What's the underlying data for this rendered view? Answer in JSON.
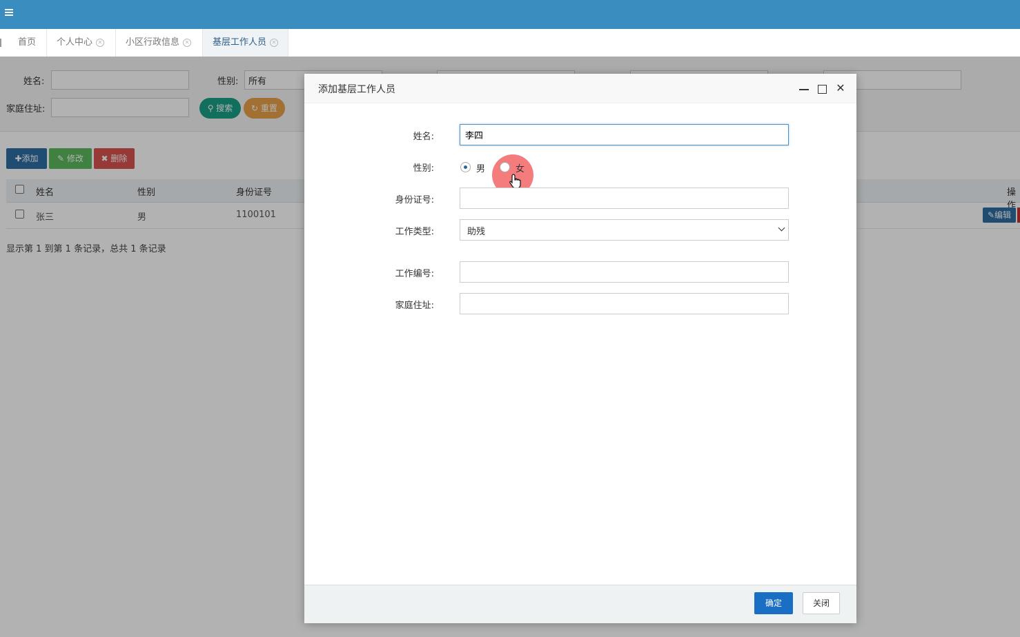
{
  "tabs": [
    {
      "label": "首页",
      "closable": false
    },
    {
      "label": "个人中心",
      "closable": true
    },
    {
      "label": "小区行政信息",
      "closable": true
    },
    {
      "label": "基层工作人员",
      "closable": true,
      "active": true
    }
  ],
  "search": {
    "name_label": "姓名:",
    "gender_label": "性别:",
    "gender_value": "所有",
    "address_label": "家庭住址:",
    "search_button": "搜索",
    "reset_button": "重置"
  },
  "toolbar": {
    "add": "添加",
    "edit": "修改",
    "delete": "删除"
  },
  "table": {
    "headers": [
      "姓名",
      "性别",
      "身份证号",
      "操作"
    ],
    "rows": [
      {
        "name": "张三",
        "gender": "男",
        "id_number": "1100101",
        "edit_label": "编辑"
      }
    ],
    "footer": "显示第 1 到第 1 条记录，总共 1 条记录"
  },
  "modal": {
    "title": "添加基层工作人员",
    "fields": {
      "name_label": "姓名:",
      "name_value": "李四",
      "gender_label": "性别:",
      "gender_male": "男",
      "gender_female": "女",
      "gender_selected": "男",
      "id_label": "身份证号:",
      "id_value": "",
      "work_type_label": "工作类型:",
      "work_type_value": "助残",
      "work_no_label": "工作编号:",
      "work_no_value": "",
      "address_label": "家庭住址:",
      "address_value": ""
    },
    "ok_button": "确定",
    "close_button": "关闭"
  },
  "colors": {
    "topbar": "#3a8dbf",
    "primary": "#1a6fc4",
    "search": "#1aa087",
    "reset": "#e8a14a"
  }
}
